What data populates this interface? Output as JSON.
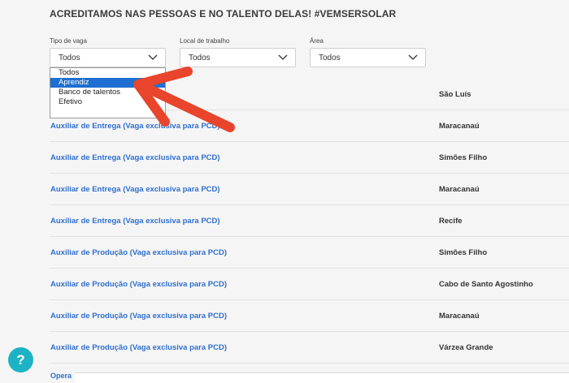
{
  "page": {
    "heading": "ACREDITAMOS NAS PESSOAS E NO TALENTO DELAS! #VEMSERSOLAR"
  },
  "filters": [
    {
      "label": "Tipo de vaga",
      "value": "Todos"
    },
    {
      "label": "Local de trabalho",
      "value": "Todos"
    },
    {
      "label": "Área",
      "value": "Todos"
    }
  ],
  "dropdown": {
    "options": [
      "Todos",
      "Aprendiz",
      "Banco de talentos",
      "Efetivo"
    ],
    "highlighted": "Aprendiz"
  },
  "jobs": [
    {
      "title": "",
      "city": "São Luís"
    },
    {
      "title": "Auxiliar de Entrega (Vaga exclusiva para PCD)",
      "city": "Maracanaú"
    },
    {
      "title": "Auxiliar de Entrega (Vaga exclusiva para PCD)",
      "city": "Simões Filho"
    },
    {
      "title": "Auxiliar de Entrega (Vaga exclusiva para PCD)",
      "city": "Maracanaú"
    },
    {
      "title": "Auxiliar de Entrega (Vaga exclusiva para PCD)",
      "city": "Recife"
    },
    {
      "title": "Auxiliar de Produção (Vaga exclusiva para PCD)",
      "city": "Simões Filho"
    },
    {
      "title": "Auxiliar de Produção (Vaga exclusiva para PCD)",
      "city": "Cabo de Santo Agostinho"
    },
    {
      "title": "Auxiliar de Produção (Vaga exclusiva para PCD)",
      "city": "Maracanaú"
    },
    {
      "title": "Auxiliar de Produção (Vaga exclusiva para PCD)",
      "city": "Várzea Grande"
    }
  ],
  "partial_row_text": "Opera",
  "help_button": {
    "label": "?"
  },
  "icons": {
    "dropdown": "chevron-down-icon",
    "annotation": "red-arrow-annotation"
  },
  "colors": {
    "link": "#2f6fcf",
    "highlight": "#1e6fd1",
    "help": "#1db3c4",
    "arrow": "#e8452c"
  }
}
